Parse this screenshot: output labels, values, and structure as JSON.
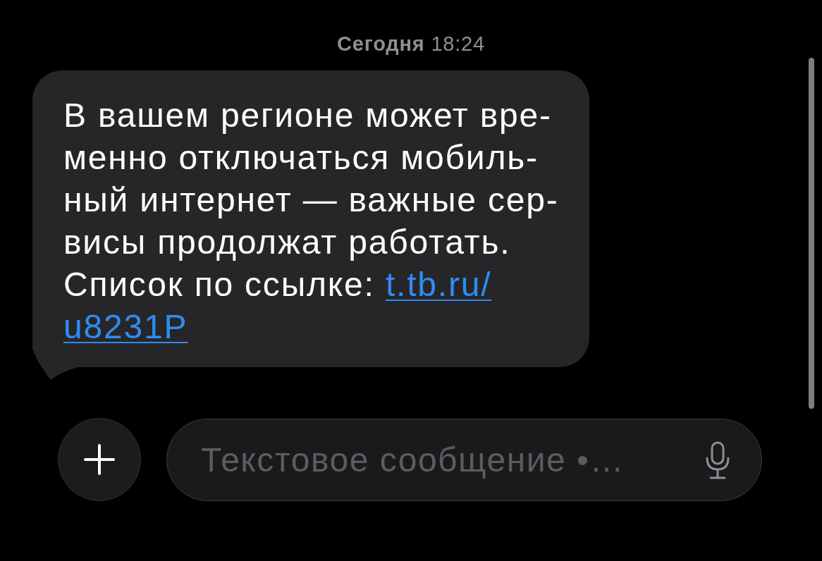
{
  "header": {
    "timestamp": "**Сегодня** 18:24"
  },
  "message": {
    "lines": [
      "В вашем регионе может вре-",
      "менно отключаться мобиль-",
      "ный интернет — важные сер-",
      "висы продолжат работать.",
      "Список по ссылке:"
    ],
    "link_lines": [
      "t.tb.ru/",
      "u8231P"
    ]
  },
  "composer": {
    "placeholder": "Текстовое сообщение •…"
  }
}
